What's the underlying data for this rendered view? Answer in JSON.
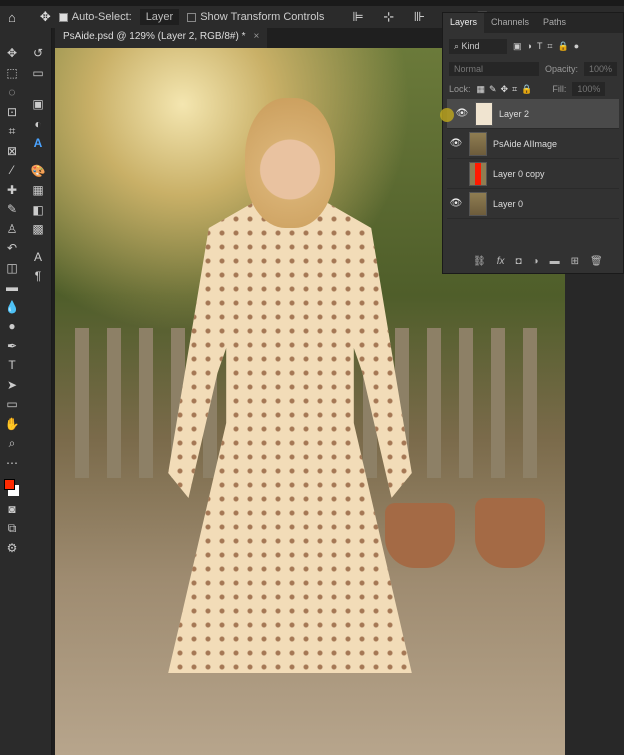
{
  "options_bar": {
    "auto_select_label": "Auto-Select:",
    "auto_select_value": "Layer",
    "show_transform_label": "Show Transform Controls"
  },
  "document_tab": {
    "title": "PsAide.psd @ 129% (Layer 2, RGB/8#) *",
    "close": "×"
  },
  "layers_panel": {
    "tabs": [
      "Layers",
      "Channels",
      "Paths"
    ],
    "filter_kind": "Kind",
    "blend_mode": "Normal",
    "opacity_label": "Opacity:",
    "opacity": "100%",
    "lock_label": "Lock:",
    "fill_label": "Fill:",
    "fill": "100%",
    "layers": [
      {
        "name": "Layer 2",
        "visible": true,
        "selected": true
      },
      {
        "name": "PsAide AIImage",
        "visible": true,
        "selected": false
      },
      {
        "name": "Layer 0 copy",
        "visible": false,
        "selected": false
      },
      {
        "name": "Layer 0",
        "visible": true,
        "selected": false
      }
    ]
  },
  "colors": {
    "foreground": "#ff2a00",
    "background": "#ffffff"
  }
}
